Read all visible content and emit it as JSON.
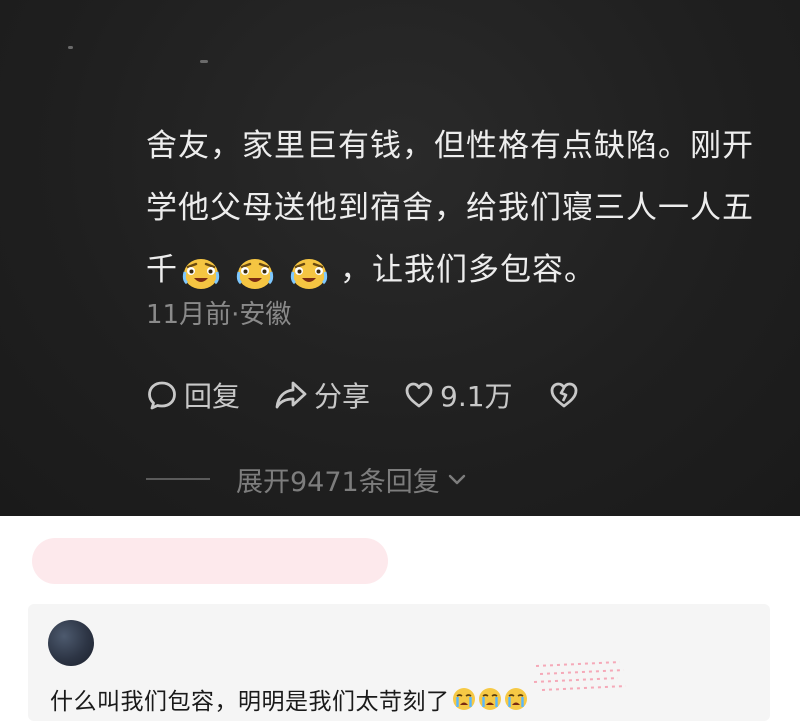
{
  "comment": {
    "line1": "舍友，家里巨有钱，但性格有点缺陷。刚开",
    "line2": "学他父母送他到宿舍，给我们寝三人一人五",
    "line3_prefix": "千",
    "line3_suffix": "，让我们多包容。",
    "emoji": "laughing-crying-face-icon",
    "meta": "11月前·安徽"
  },
  "actions": {
    "reply_label": "回复",
    "share_label": "分享",
    "like_count": "9.1万"
  },
  "expand": {
    "label": "展开9471条回复"
  },
  "reply": {
    "text": "什么叫我们包容，明明是我们太苛刻了",
    "emoji": "crying-face-icon"
  },
  "colors": {
    "dark_bg": "#1f1f1f",
    "comment_text": "#ededed",
    "meta_text": "#8a8a8a",
    "pink_bar": "#fde9ec",
    "reply_card_bg": "#f5f5f5"
  }
}
